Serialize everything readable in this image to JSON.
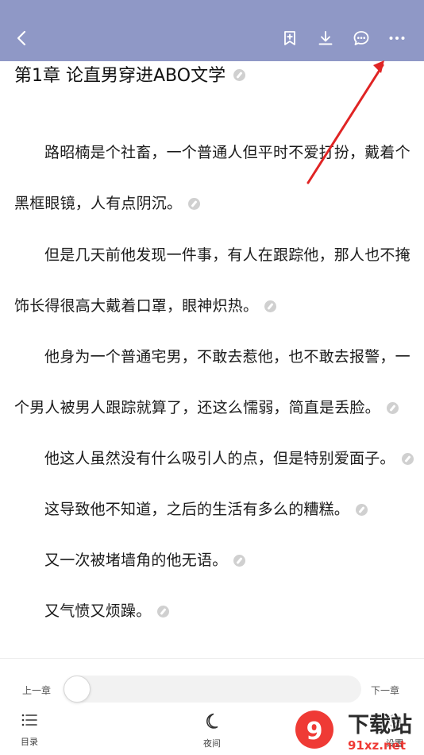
{
  "chapter": {
    "title": "第1章 论直男穿进ABO文学"
  },
  "paragraphs": [
    "路昭楠是个社畜，一个普通人但平时不爱打扮，戴着个黑框眼镜，人有点阴沉。",
    "但是几天前他发现一件事，有人在跟踪他，那人也不掩饰长得很高大戴着口罩，眼神炽热。",
    "他身为一个普通宅男，不敢去惹他，也不敢去报警，一个男人被男人跟踪就算了，还这么懦弱，简直是丢脸。",
    "他这人虽然没有什么吸引人的点，但是特别爱面子。",
    "这导致他不知道，之后的生活有多么的糟糕。",
    "又一次被堵墙角的他无语。",
    "又气愤又烦躁。"
  ],
  "bottom": {
    "prev_chapter": "上一章",
    "next_chapter": "下一章",
    "progress": 0.0,
    "tabs": {
      "toc": "目录",
      "night": "夜间",
      "settings": "设置"
    }
  },
  "watermark": {
    "main": "下载站",
    "sub": "91xz.net"
  },
  "colors": {
    "topbar": "#8f98c6",
    "annotation_arrow": "#e02424"
  },
  "icons": {
    "back": "chevron-left-icon",
    "bookmark": "bookmark-add-icon",
    "download": "download-icon",
    "comment": "comment-bubble-icon",
    "more": "more-dots-icon",
    "toc": "list-icon",
    "night": "moon-icon",
    "settings": "gear-icon"
  }
}
